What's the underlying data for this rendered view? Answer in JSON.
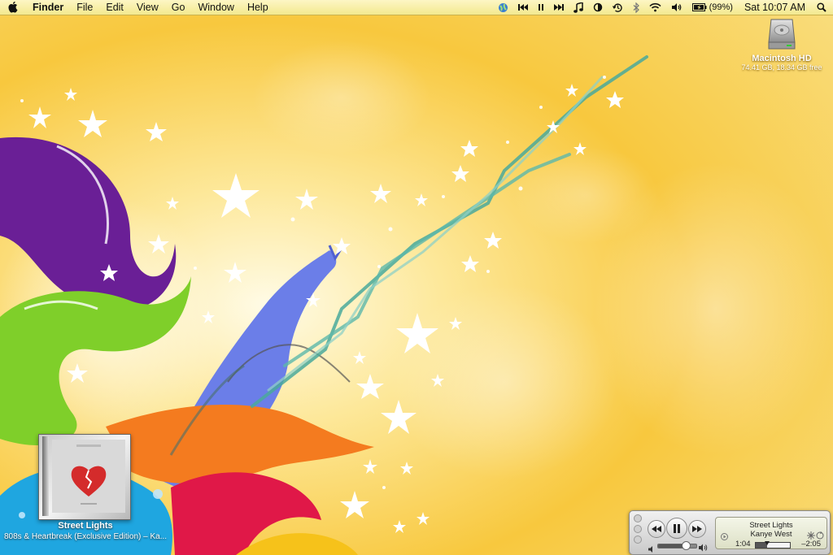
{
  "menubar": {
    "app_name": "Finder",
    "menus": [
      "File",
      "Edit",
      "View",
      "Go",
      "Window",
      "Help"
    ],
    "battery_percent": "(99%)",
    "clock": "Sat 10:07 AM",
    "status_icons": [
      "network-globe-icon",
      "itunes-previous-icon",
      "itunes-pause-icon",
      "itunes-next-icon",
      "music-note-icon",
      "sync-icon",
      "time-machine-icon",
      "bluetooth-icon",
      "wifi-icon",
      "volume-icon",
      "battery-icon",
      "spotlight-icon"
    ]
  },
  "desktop": {
    "drive_name": "Macintosh HD",
    "drive_info": "74.41 GB, 18.34 GB free"
  },
  "album_widget": {
    "track": "Street Lights",
    "album_artist": "808s & Heartbreak (Exclusive Edition) – Ka..."
  },
  "mini_player": {
    "track": "Street Lights",
    "artist": "Kanye West",
    "elapsed": "1:04",
    "remaining": "–2:05",
    "progress": 0.34,
    "volume": 0.72
  },
  "colors": {
    "sky": "#f7c53d",
    "menubar": "#f6eda6",
    "purple": "#6a1f96",
    "green": "#7fcf2a",
    "blue": "#6b7ee8",
    "orange": "#f47b1f",
    "red": "#e01848",
    "cyan": "#1fa6e0"
  }
}
